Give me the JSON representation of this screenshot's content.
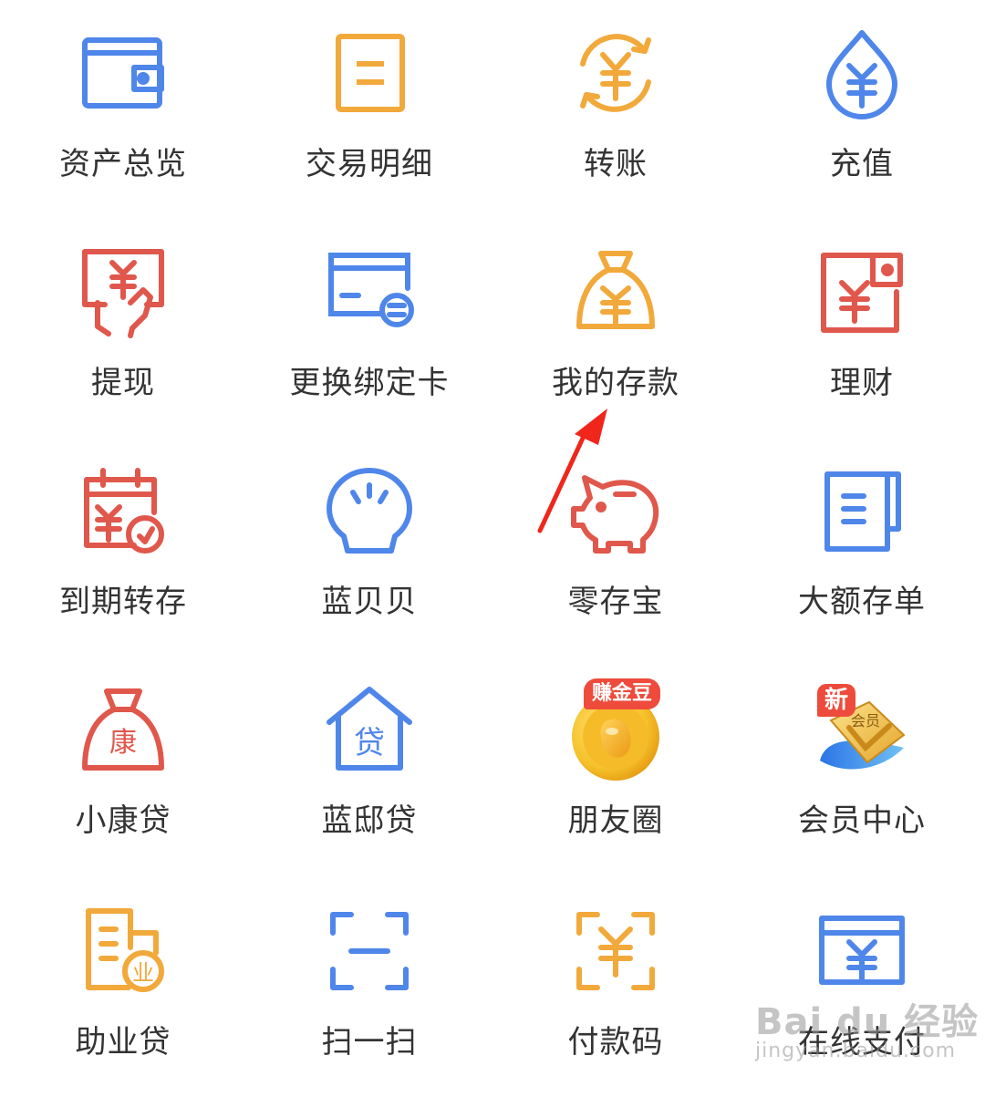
{
  "colors": {
    "blue": "#4f86ea",
    "orange": "#f2a93b",
    "red": "#e0574c",
    "text": "#333333",
    "annotation_arrow": "#f0261b"
  },
  "services": [
    {
      "label": "资产总览",
      "icon": "wallet-icon"
    },
    {
      "label": "交易明细",
      "icon": "document-list-icon"
    },
    {
      "label": "转账",
      "icon": "yuan-transfer-icon"
    },
    {
      "label": "充值",
      "icon": "yuan-drop-icon"
    },
    {
      "label": "提现",
      "icon": "withdraw-hand-icon"
    },
    {
      "label": "更换绑定卡",
      "icon": "bank-card-exchange-icon"
    },
    {
      "label": "我的存款",
      "icon": "money-bag-icon"
    },
    {
      "label": "理财",
      "icon": "wealth-wallet-icon"
    },
    {
      "label": "到期转存",
      "icon": "calendar-renew-icon"
    },
    {
      "label": "蓝贝贝",
      "icon": "shell-icon"
    },
    {
      "label": "零存宝",
      "icon": "piggy-bank-icon"
    },
    {
      "label": "大额存单",
      "icon": "certificate-icon"
    },
    {
      "label": "小康贷",
      "icon": "kang-bag-icon",
      "icon_text": "康"
    },
    {
      "label": "蓝邸贷",
      "icon": "house-loan-icon",
      "icon_text": "贷"
    },
    {
      "label": "朋友圈",
      "icon": "gold-bean-coin-icon",
      "badge": "赚金豆"
    },
    {
      "label": "会员中心",
      "icon": "member-card-icon",
      "badge": "新",
      "icon_text": "会员"
    },
    {
      "label": "助业贷",
      "icon": "business-loan-icon",
      "icon_text": "业"
    },
    {
      "label": "扫一扫",
      "icon": "scan-icon"
    },
    {
      "label": "付款码",
      "icon": "payment-code-icon"
    },
    {
      "label": "在线支付",
      "icon": "online-payment-icon"
    }
  ],
  "watermark": {
    "main": "Bai du 经验",
    "sub": "jingyan.baidu.com"
  }
}
